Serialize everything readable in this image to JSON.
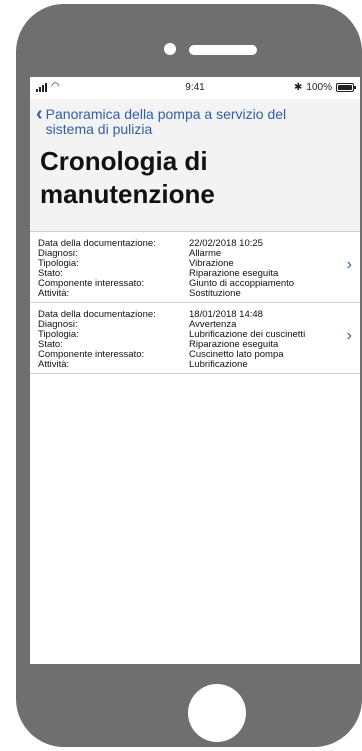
{
  "status_bar": {
    "time": "9:41",
    "battery": "100%",
    "battery_level": 1.0
  },
  "nav": {
    "back_label": "Panoramica della pompa a servizio del sistema di pulizia"
  },
  "title": "Cronologia di manutenzione",
  "labels": {
    "date": "Data della documentazione:",
    "diagnosis": "Diagnosi:",
    "type": "Tipologia:",
    "status": "Stato:",
    "component": "Componente interessato:",
    "activity": "Attività:"
  },
  "records": [
    {
      "date": "22/02/2018  10:25",
      "diagnosis": "Allarme",
      "type": "Vibrazione",
      "status": "Riparazione eseguita",
      "component": "Giunto di accoppiamento",
      "activity": "Sostituzione"
    },
    {
      "date": "18/01/2018  14:48",
      "diagnosis": "Avvertenza",
      "type": "Lubrificazione dei cuscinetti",
      "status": "Riparazione eseguita",
      "component": "Cuscinetto lato pompa",
      "activity": "Lubrificazione"
    }
  ]
}
